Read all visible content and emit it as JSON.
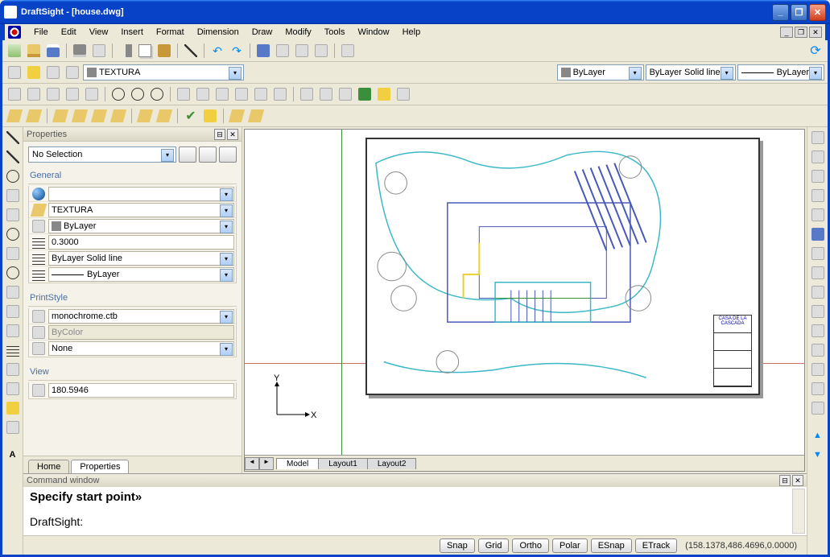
{
  "titlebar": {
    "text": "DraftSight - [house.dwg]"
  },
  "menu": [
    "File",
    "Edit",
    "View",
    "Insert",
    "Format",
    "Dimension",
    "Draw",
    "Modify",
    "Tools",
    "Window",
    "Help"
  ],
  "layer_combo": "TEXTURA",
  "style_combos": {
    "color": "ByLayer",
    "style": "ByLayer   Solid line",
    "weight": "ByLayer"
  },
  "properties": {
    "title": "Properties",
    "selection": "No Selection",
    "groups": {
      "general": {
        "title": "General",
        "rows": [
          {
            "key": "color",
            "value": "",
            "combo": true
          },
          {
            "key": "layer",
            "value": "TEXTURA",
            "combo": true
          },
          {
            "key": "linecolor",
            "value": "ByLayer",
            "combo": true,
            "swatch": true
          },
          {
            "key": "scale",
            "value": "0.3000",
            "combo": false
          },
          {
            "key": "linestyle",
            "value": "ByLayer   Solid line",
            "combo": true
          },
          {
            "key": "lineweight",
            "value": "ByLayer",
            "combo": true,
            "line": true
          }
        ]
      },
      "printstyle": {
        "title": "PrintStyle",
        "rows": [
          {
            "key": "style",
            "value": "monochrome.ctb",
            "combo": true
          },
          {
            "key": "bycolor",
            "value": "ByColor",
            "combo": false,
            "disabled": true
          },
          {
            "key": "none",
            "value": "None",
            "combo": true
          }
        ]
      },
      "view": {
        "title": "View",
        "rows": [
          {
            "key": "x",
            "value": "180.5946",
            "combo": false
          }
        ]
      }
    }
  },
  "panel_tabs": [
    "Home",
    "Properties"
  ],
  "canvas_tabs": [
    "Model",
    "Layout1",
    "Layout2"
  ],
  "legend_title": "CASA DE LA CASCADA",
  "command": {
    "title": "Command window",
    "prompt": "Specify start point»",
    "app": "DraftSight:"
  },
  "status": {
    "buttons": [
      "Snap",
      "Grid",
      "Ortho",
      "Polar",
      "ESnap",
      "ETrack"
    ],
    "coords": "(158.1378,486.4696,0.0000)"
  }
}
